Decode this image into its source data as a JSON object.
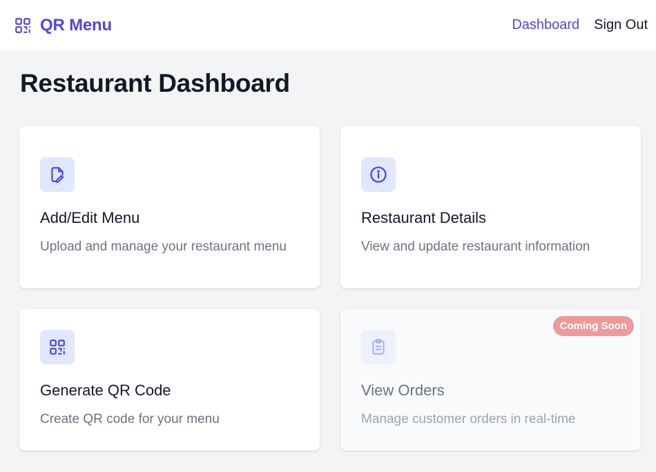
{
  "app": {
    "name": "QR Menu"
  },
  "nav": {
    "dashboard": "Dashboard",
    "sign_out": "Sign Out"
  },
  "page": {
    "title": "Restaurant Dashboard"
  },
  "cards": [
    {
      "title": "Add/Edit Menu",
      "description": "Upload and manage your restaurant menu",
      "icon": "document-edit-icon"
    },
    {
      "title": "Restaurant Details",
      "description": "View and update restaurant information",
      "icon": "info-circle-icon"
    },
    {
      "title": "Generate QR Code",
      "description": "Create QR code for your menu",
      "icon": "qr-code-icon"
    },
    {
      "title": "View Orders",
      "description": "Manage customer orders in real-time",
      "icon": "clipboard-icon",
      "badge": "Coming Soon"
    }
  ],
  "colors": {
    "accent": "#4f46e5",
    "icon_bg": "#e0e7ff",
    "badge": "#ee9a9a",
    "page_bg": "#f3f4f6"
  }
}
